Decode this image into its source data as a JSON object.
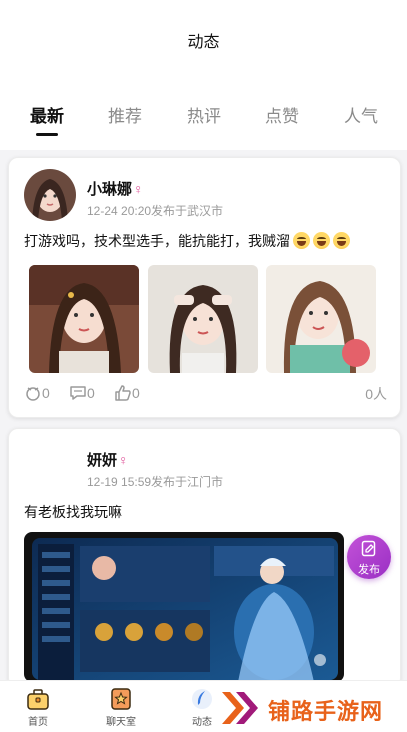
{
  "page": {
    "title": "动态"
  },
  "tabs": [
    {
      "label": "最新",
      "active": true
    },
    {
      "label": "推荐",
      "active": false
    },
    {
      "label": "热评",
      "active": false
    },
    {
      "label": "点赞",
      "active": false
    },
    {
      "label": "人气",
      "active": false
    }
  ],
  "posts": [
    {
      "username": "小琳娜",
      "gender": "female",
      "meta": "12-24 20:20发布于武汉市",
      "text": "打游戏吗，技术型选手，能抗能打，我贼溜",
      "emoji": "grinning-face-with-sweat",
      "emoji_count": 3,
      "image_count": 3,
      "gifts": "0",
      "comments": "0",
      "likes": "0",
      "views": "0人"
    },
    {
      "username": "妍妍",
      "gender": "female",
      "meta": "12-19 15:59发布于江门市",
      "text": "有老板找我玩嘛",
      "image_count": 1
    }
  ],
  "fab": {
    "label": "发布",
    "icon": "edit-icon"
  },
  "bottom_nav": [
    {
      "label": "首页",
      "icon": "briefcase-icon"
    },
    {
      "label": "聊天室",
      "icon": "star-badge-icon"
    },
    {
      "label": "动态",
      "icon": "feather-icon"
    }
  ],
  "watermark": {
    "text": "铺路手游网"
  },
  "colors": {
    "accent_purple": "#b03fd0",
    "female": "#e0559a",
    "watermark_orange": "#e8621a"
  }
}
